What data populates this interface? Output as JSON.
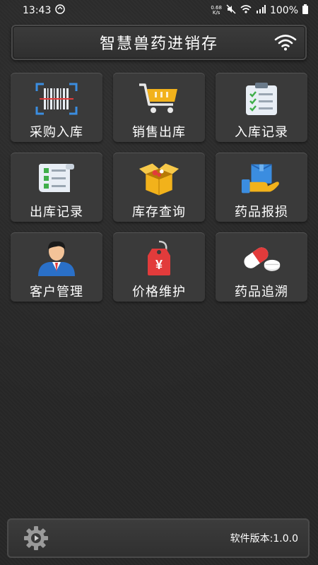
{
  "status_bar": {
    "time": "13:43",
    "net_speed_value": "0.68",
    "net_speed_unit": "K/s",
    "battery": "100%"
  },
  "header": {
    "title": "智慧兽药进销存",
    "wifi_icon": "wifi-icon"
  },
  "menu": {
    "items": [
      {
        "label": "采购入库",
        "icon": "barcode-scan-icon"
      },
      {
        "label": "销售出库",
        "icon": "shopping-cart-icon"
      },
      {
        "label": "入库记录",
        "icon": "clipboard-checklist-icon"
      },
      {
        "label": "出库记录",
        "icon": "receipt-list-icon"
      },
      {
        "label": "库存查询",
        "icon": "open-box-icon"
      },
      {
        "label": "药品报损",
        "icon": "box-in-hand-icon"
      },
      {
        "label": "客户管理",
        "icon": "businessman-icon"
      },
      {
        "label": "价格维护",
        "icon": "price-tag-icon"
      },
      {
        "label": "药品追溯",
        "icon": "pill-capsule-icon"
      }
    ]
  },
  "footer": {
    "settings_icon": "settings-gear-icon",
    "version": "软件版本:1.0.0"
  },
  "colors": {
    "tile_bg": "#3a3a3a",
    "accent_blue": "#3b8de0",
    "accent_yellow": "#f2b21b",
    "accent_red": "#e23b3b"
  }
}
